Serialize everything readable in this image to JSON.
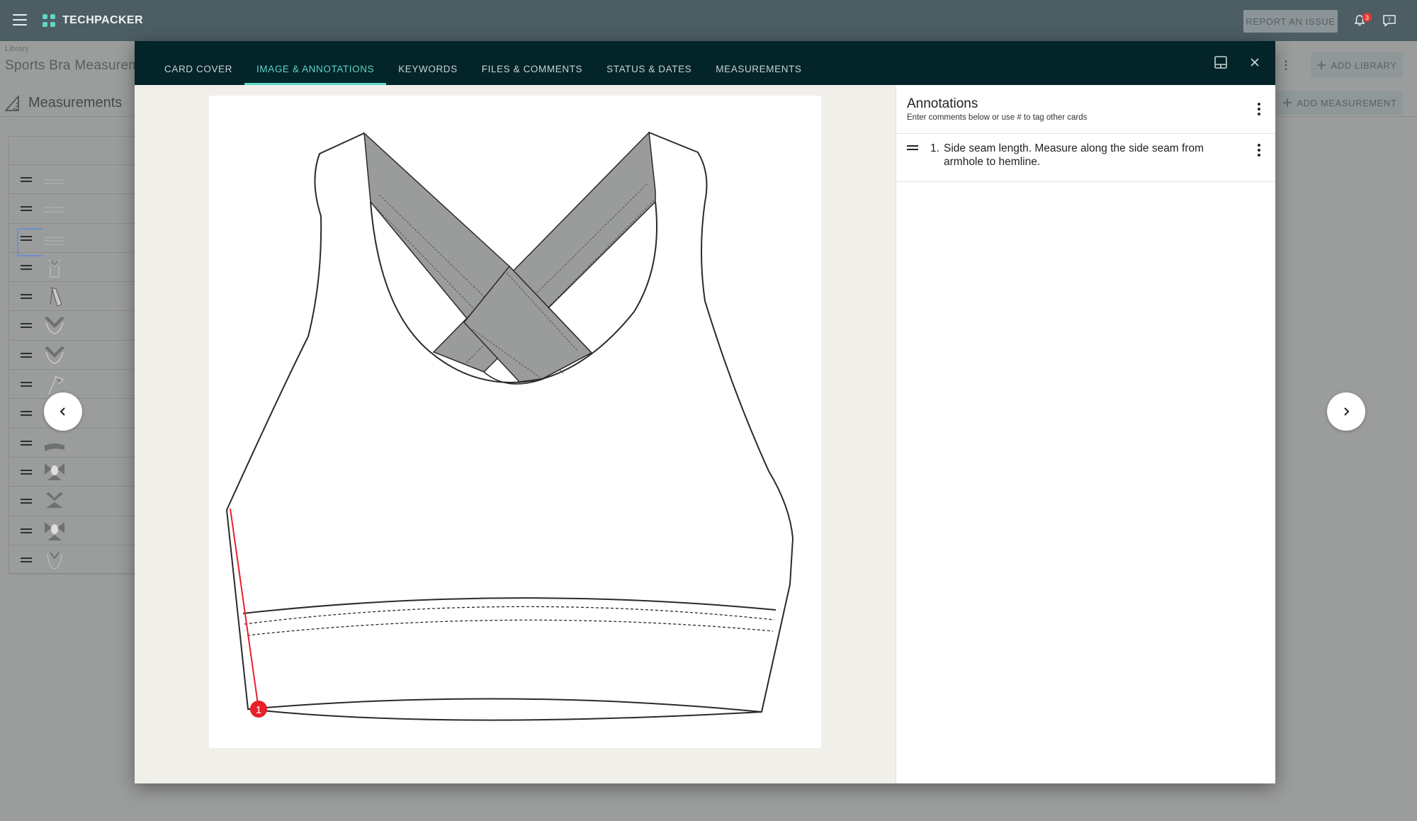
{
  "app": {
    "brand": "TECHPACKER",
    "report_label": "REPORT AN ISSUE",
    "notification_count": "3"
  },
  "library": {
    "label": "Library",
    "title": "Sports Bra Measurements",
    "add_library_label": "ADD LIBRARY"
  },
  "measurements": {
    "title": "Measurements",
    "add_label": "ADD MEASUREMENT"
  },
  "modal": {
    "tabs": [
      {
        "label": "CARD COVER",
        "active": false
      },
      {
        "label": "IMAGE & ANNOTATIONS",
        "active": true
      },
      {
        "label": "KEYWORDS",
        "active": false
      },
      {
        "label": "FILES & COMMENTS",
        "active": false
      },
      {
        "label": "STATUS & DATES",
        "active": false
      },
      {
        "label": "MEASUREMENTS",
        "active": false
      }
    ],
    "annotations": {
      "title": "Annotations",
      "subtitle": "Enter comments below or use # to tag other cards",
      "items": [
        {
          "number": "1.",
          "text": "Side seam length. Measure along the side seam from armhole to hemline.",
          "marker": "1"
        }
      ]
    }
  },
  "icons": {
    "menu": "hamburger-menu-icon",
    "logo": "techpacker-logo-icon",
    "bell": "bell-icon",
    "feedback": "feedback-icon",
    "layout": "layout-toggle-icon",
    "close": "close-icon",
    "prev": "chevron-left-icon",
    "next": "chevron-right-icon"
  },
  "colors": {
    "topbar": "#4c5d64",
    "modal_header": "#032429",
    "active_tab": "#5fd7c7",
    "annotation_marker": "#e8202a"
  }
}
